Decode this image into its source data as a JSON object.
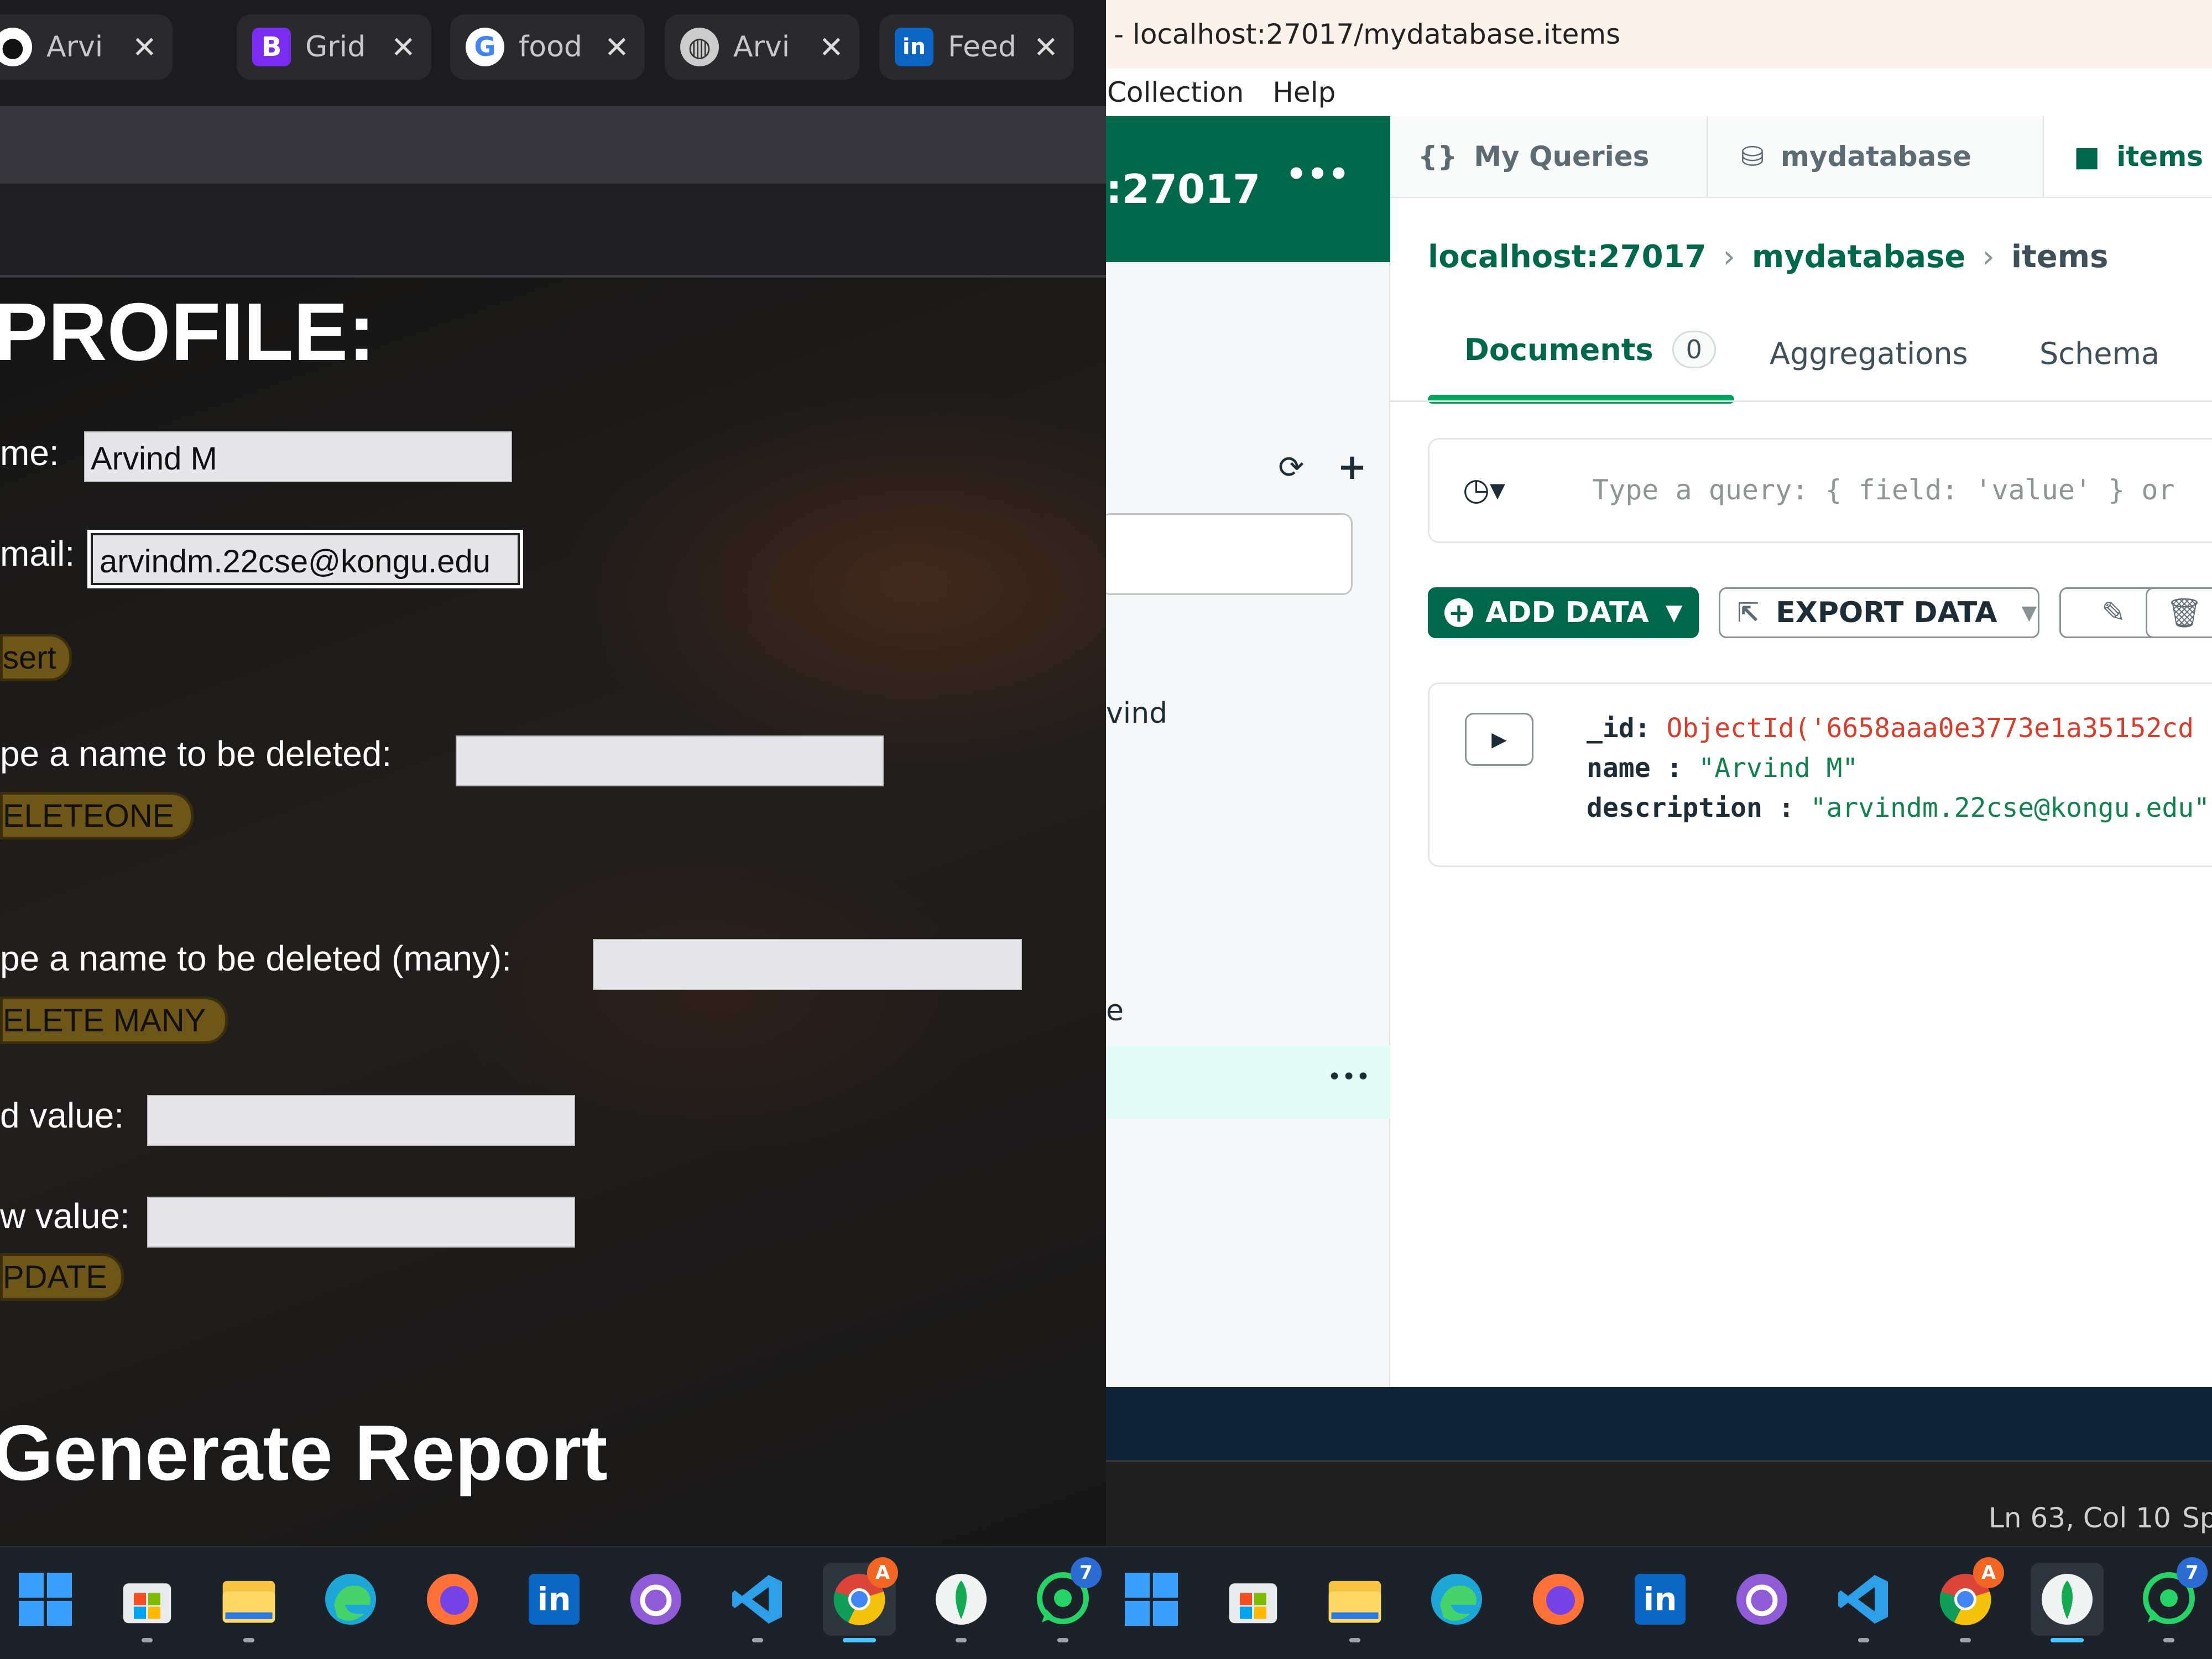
{
  "browser": {
    "tabs": [
      {
        "icon": "github-icon",
        "label": "Arvi"
      },
      {
        "icon": "bootstrap-icon",
        "label": "Grid"
      },
      {
        "icon": "google-icon",
        "label": "food"
      },
      {
        "icon": "globe-icon",
        "label": "Arvi"
      },
      {
        "icon": "linkedin-icon",
        "label": "Feed"
      }
    ],
    "page": {
      "heading": "PROFILE:",
      "name_label": "me:",
      "name_value": "Arvind M",
      "email_label": "mail:",
      "email_value": "arvindm.22cse@kongu.edu",
      "insert_button": "sert",
      "delete_one_label": "pe a name to be deleted:",
      "delete_one_button": "ELETEONE",
      "delete_many_label": "pe a name to be deleted (many):",
      "delete_many_button": "ELETE MANY",
      "old_value_label": "d value:",
      "new_value_label": "w value:",
      "update_button": "PDATE",
      "report_heading": "Generate Report"
    }
  },
  "compass": {
    "window_title": "- localhost:27017/mydatabase.items",
    "menu": [
      "Collection",
      "Help"
    ],
    "connection_name": ":27017",
    "sidebar_partial_item": "vind",
    "sidebar_partial_item2": "e",
    "workspace_tabs": [
      {
        "icon": "braces-icon",
        "label": "My Queries"
      },
      {
        "icon": "database-icon",
        "label": "mydatabase"
      },
      {
        "icon": "folder-icon",
        "label": "items"
      }
    ],
    "breadcrumb": [
      "localhost:27017",
      "mydatabase",
      "items"
    ],
    "collection_tabs": {
      "documents": "Documents",
      "documents_count": "0",
      "aggregations": "Aggregations",
      "schema": "Schema"
    },
    "query_placeholder": "Type a query: { field: 'value' } or",
    "add_data": "ADD DATA",
    "export_data": "EXPORT DATA",
    "document": {
      "id_key": "_id:",
      "id_value": "ObjectId('6658aaa0e3773e1a35152cd",
      "name_key": "name :",
      "name_value": "\"Arvind M\"",
      "desc_key": "description :",
      "desc_value": "\"arvindm.22cse@kongu.edu\""
    },
    "status_position": "Ln 63, Col 10",
    "status_partial": "Sp"
  },
  "taskbar": {
    "left_apps": [
      "windows-start-icon",
      "microsoft-store-icon",
      "file-explorer-icon",
      "edge-icon",
      "firefox-icon",
      "linkedin-icon",
      "github-desktop-icon",
      "vscode-icon",
      "chrome-icon",
      "mongodb-compass-icon",
      "whatsapp-icon"
    ],
    "right_apps": [
      "windows-start-icon",
      "microsoft-store-icon",
      "file-explorer-icon",
      "edge-icon",
      "firefox-icon",
      "linkedin-icon",
      "github-desktop-icon",
      "vscode-icon",
      "chrome-icon",
      "mongodb-compass-icon",
      "whatsapp-icon"
    ],
    "chrome_badge": "A",
    "whatsapp_badge": "7"
  },
  "colors": {
    "compass_green": "#00684a",
    "accent_green": "#00ed64",
    "button_gold": "#6e5518",
    "objectid_red": "#d83c2b"
  }
}
